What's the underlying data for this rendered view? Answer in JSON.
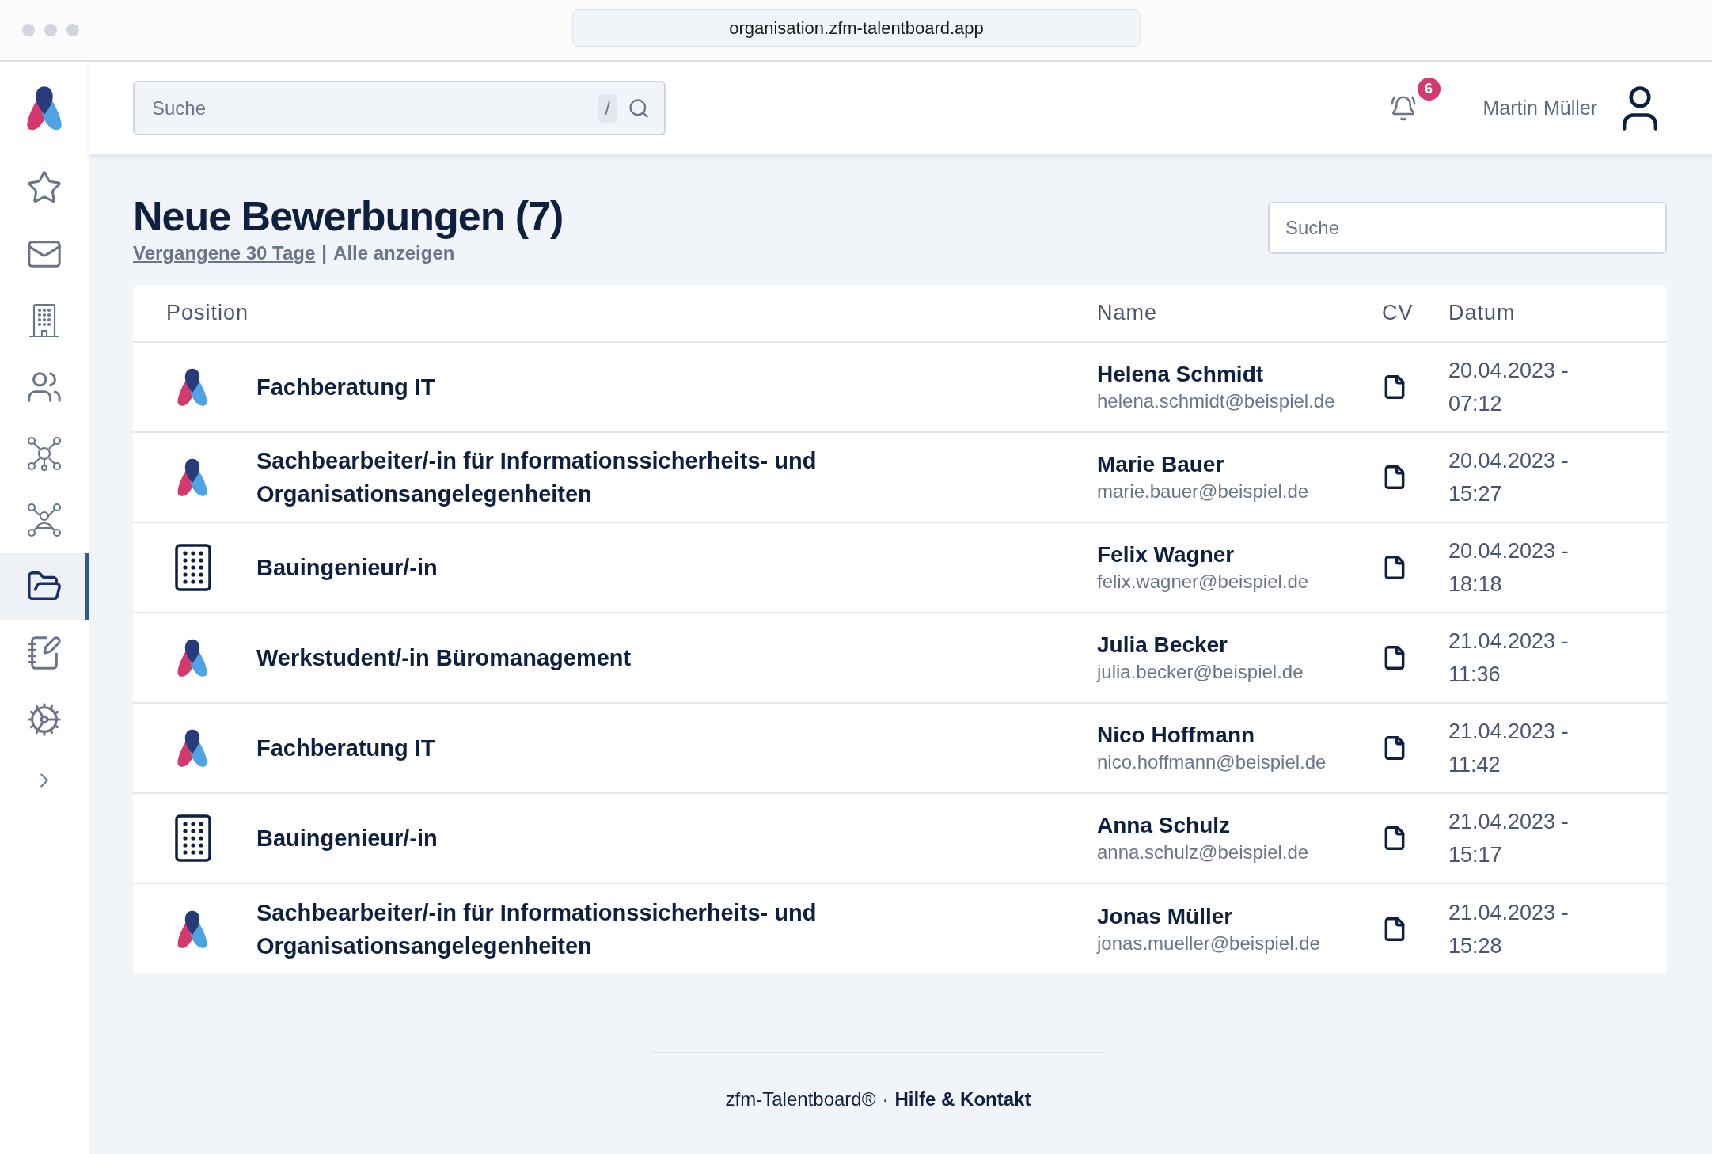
{
  "browser": {
    "url": "organisation.zfm-talentboard.app"
  },
  "sidebar": {
    "items": [
      {
        "selected": false
      },
      {
        "selected": false
      },
      {
        "selected": false
      },
      {
        "selected": false
      },
      {
        "selected": false
      },
      {
        "selected": false
      },
      {
        "selected": true
      },
      {
        "selected": false
      },
      {
        "selected": false
      }
    ]
  },
  "header": {
    "search": {
      "placeholder": "Suche",
      "shortcut": "/"
    },
    "notifications": {
      "count": "6"
    },
    "user": {
      "name": "Martin Müller"
    }
  },
  "page": {
    "title": "Neue Bewerbungen (7)",
    "filters": [
      {
        "label": "Vergangene 30 Tage",
        "selected": true
      },
      {
        "label": "Alle anzeigen",
        "selected": false
      }
    ],
    "separator": "|",
    "search": {
      "placeholder": "Suche"
    }
  },
  "table": {
    "columns": [
      "Position",
      "Name",
      "CV",
      "Datum"
    ],
    "rows": [
      {
        "kind": "logo",
        "position": "Fachberatung IT",
        "name": "Helena Schmidt",
        "email": "helena.schmidt@beispiel.de",
        "date": "20.04.2023 -",
        "time": "07:12"
      },
      {
        "kind": "logo",
        "position": "Sachbearbeiter/-in für Informationssicherheits- und Organisationsangelegenheiten",
        "name": "Marie Bauer",
        "email": "marie.bauer@beispiel.de",
        "date": "20.04.2023 -",
        "time": "15:27"
      },
      {
        "kind": "building",
        "position": "Bauingenieur/-in",
        "name": "Felix Wagner",
        "email": "felix.wagner@beispiel.de",
        "date": "20.04.2023 -",
        "time": "18:18"
      },
      {
        "kind": "logo",
        "position": "Werkstudent/-in Büromanagement",
        "name": "Julia Becker",
        "email": "julia.becker@beispiel.de",
        "date": "21.04.2023 -",
        "time": "11:36"
      },
      {
        "kind": "logo",
        "position": "Fachberatung IT",
        "name": "Nico Hoffmann",
        "email": "nico.hoffmann@beispiel.de",
        "date": "21.04.2023 -",
        "time": "11:42"
      },
      {
        "kind": "building",
        "position": "Bauingenieur/-in",
        "name": "Anna Schulz",
        "email": "anna.schulz@beispiel.de",
        "date": "21.04.2023 -",
        "time": "15:17"
      },
      {
        "kind": "logo",
        "position": "Sachbearbeiter/-in für Informationssicherheits- und Organisationsangelegenheiten",
        "name": "Jonas Müller",
        "email": "jonas.mueller@beispiel.de",
        "date": "21.04.2023 -",
        "time": "15:28"
      }
    ]
  },
  "footer": {
    "brand": "zfm-Talentboard®",
    "separator": "·",
    "link": "Hilfe & Kontakt"
  }
}
